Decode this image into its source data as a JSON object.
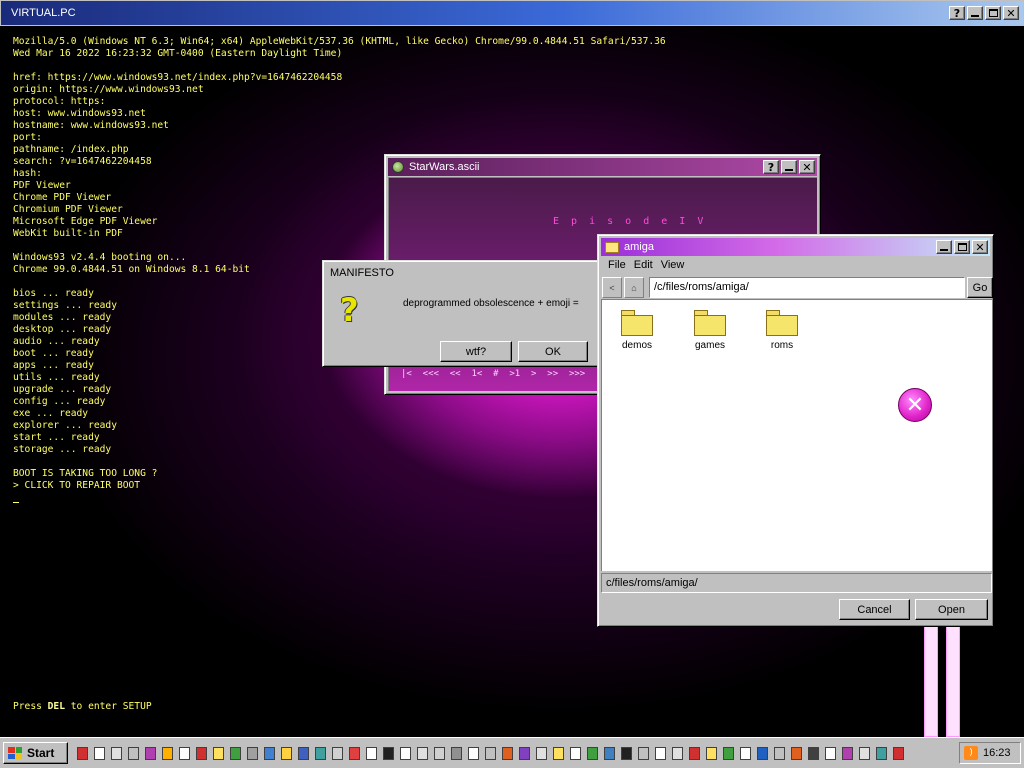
{
  "outer_window": {
    "title": "VIRTUAL.PC",
    "help_glyph": "?",
    "close_glyph": "✕"
  },
  "boot_log": {
    "lines": [
      "Mozilla/5.0 (Windows NT 6.3; Win64; x64) AppleWebKit/537.36 (KHTML, like Gecko) Chrome/99.0.4844.51 Safari/537.36",
      "Wed Mar 16 2022 16:23:32 GMT-0400 (Eastern Daylight Time)",
      "",
      "href: https://www.windows93.net/index.php?v=1647462204458",
      "origin: https://www.windows93.net",
      "protocol: https:",
      "host: www.windows93.net",
      "hostname: www.windows93.net",
      "port:",
      "pathname: /index.php",
      "search: ?v=1647462204458",
      "hash:",
      "PDF Viewer",
      "Chrome PDF Viewer",
      "Chromium PDF Viewer",
      "Microsoft Edge PDF Viewer",
      "WebKit built-in PDF",
      "",
      "Windows93 v2.4.4 booting on...",
      "Chrome 99.0.4844.51 on Windows 8.1 64-bit",
      "",
      "bios ... ready",
      "settings ... ready",
      "modules ... ready",
      "desktop ... ready",
      "audio ... ready",
      "boot ... ready",
      "apps ... ready",
      "utils ... ready",
      "upgrade ... ready",
      "config ... ready",
      "exe ... ready",
      "explorer ... ready",
      "start ... ready",
      "storage ... ready",
      "",
      "BOOT IS TAKING TOO LONG ?",
      "> CLICK TO REPAIR BOOT"
    ],
    "setup_prefix": "Press ",
    "setup_key": "DEL",
    "setup_suffix": " to enter SETUP"
  },
  "starwars_window": {
    "title": "StarWars.ascii",
    "episode_text": "E p i s o d e I V",
    "nav_text": "|<  <<<  <<  1<  #  >1  >  >>  >>>"
  },
  "manifesto_dialog": {
    "title": "MANIFESTO",
    "icon_glyph": "?",
    "message": "deprogrammed obsolescence + emoji =",
    "wtf_label": "wtf?",
    "ok_label": "OK"
  },
  "amiga_window": {
    "title": "amiga",
    "menu": [
      "File",
      "Edit",
      "View"
    ],
    "back_glyph": "<",
    "home_glyph": "⌂",
    "address": "/c/files/roms/amiga/",
    "go_label": "Go",
    "items": [
      {
        "label": "demos"
      },
      {
        "label": "games"
      },
      {
        "label": "roms"
      }
    ],
    "close_glyph": "✕",
    "status_path": "c/files/roms/amiga/",
    "cancel_label": "Cancel",
    "open_label": "Open"
  },
  "taskbar": {
    "start_label": "Start",
    "clock": "16:23",
    "rss_glyph": ")",
    "quick_launch_icons": [
      {
        "name": "app-icon-1",
        "color": "#d03030"
      },
      {
        "name": "app-icon-2",
        "color": "#ffffff"
      },
      {
        "name": "app-icon-3",
        "color": "#e0e0e0"
      },
      {
        "name": "app-icon-4",
        "color": "#c0c0c0"
      },
      {
        "name": "app-icon-5",
        "color": "#b040b0"
      },
      {
        "name": "app-icon-6",
        "color": "#ffb000"
      },
      {
        "name": "app-icon-7",
        "color": "#ffffff"
      },
      {
        "name": "app-icon-8",
        "color": "#d03030"
      },
      {
        "name": "app-icon-9",
        "color": "#ffe060"
      },
      {
        "name": "app-icon-10",
        "color": "#40a040"
      },
      {
        "name": "app-icon-11",
        "color": "#a0a0a0"
      },
      {
        "name": "app-icon-12",
        "color": "#4080d0"
      },
      {
        "name": "app-icon-13",
        "color": "#ffd040"
      },
      {
        "name": "app-icon-14",
        "color": "#4060c0"
      },
      {
        "name": "app-icon-15",
        "color": "#40a0a0"
      },
      {
        "name": "app-icon-16",
        "color": "#d0d0d0"
      },
      {
        "name": "app-icon-17",
        "color": "#e04040"
      },
      {
        "name": "app-icon-18",
        "color": "#ffffff"
      },
      {
        "name": "app-icon-19",
        "color": "#202020"
      },
      {
        "name": "app-icon-20",
        "color": "#ffffff"
      },
      {
        "name": "app-icon-21",
        "color": "#e0e0e0"
      },
      {
        "name": "app-icon-22",
        "color": "#d0d0d0"
      },
      {
        "name": "app-icon-23",
        "color": "#909090"
      },
      {
        "name": "app-icon-24",
        "color": "#ffffff"
      },
      {
        "name": "app-icon-25",
        "color": "#c0c0c0"
      },
      {
        "name": "app-icon-26",
        "color": "#e06020"
      },
      {
        "name": "app-icon-27",
        "color": "#8040c0"
      },
      {
        "name": "app-icon-28",
        "color": "#e0e0e0"
      },
      {
        "name": "app-icon-29",
        "color": "#ffe060"
      },
      {
        "name": "app-icon-30",
        "color": "#ffffff"
      },
      {
        "name": "app-icon-31",
        "color": "#40a040"
      },
      {
        "name": "app-icon-32",
        "color": "#4080c0"
      },
      {
        "name": "app-icon-33",
        "color": "#202020"
      },
      {
        "name": "app-icon-34",
        "color": "#c0c0c0"
      },
      {
        "name": "app-icon-35",
        "color": "#ffffff"
      },
      {
        "name": "app-icon-36",
        "color": "#e0e0e0"
      },
      {
        "name": "app-icon-37",
        "color": "#d03030"
      },
      {
        "name": "app-icon-38",
        "color": "#ffe060"
      },
      {
        "name": "app-icon-39",
        "color": "#40a040"
      },
      {
        "name": "app-icon-40",
        "color": "#ffffff"
      },
      {
        "name": "app-icon-41",
        "color": "#2060c0"
      },
      {
        "name": "app-icon-42",
        "color": "#c0c0c0"
      },
      {
        "name": "app-icon-43",
        "color": "#e06020"
      },
      {
        "name": "app-icon-44",
        "color": "#404040"
      },
      {
        "name": "app-icon-45",
        "color": "#ffffff"
      },
      {
        "name": "app-icon-46",
        "color": "#b040b0"
      },
      {
        "name": "app-icon-47",
        "color": "#e0e0e0"
      },
      {
        "name": "app-icon-48",
        "color": "#40a0a0"
      },
      {
        "name": "app-icon-49",
        "color": "#d03030"
      }
    ]
  },
  "colors": {
    "terminal_text": "#ffff66",
    "desktop_glow": "#d317c4",
    "explorer_title_gradient_start": "#9b30d8"
  }
}
